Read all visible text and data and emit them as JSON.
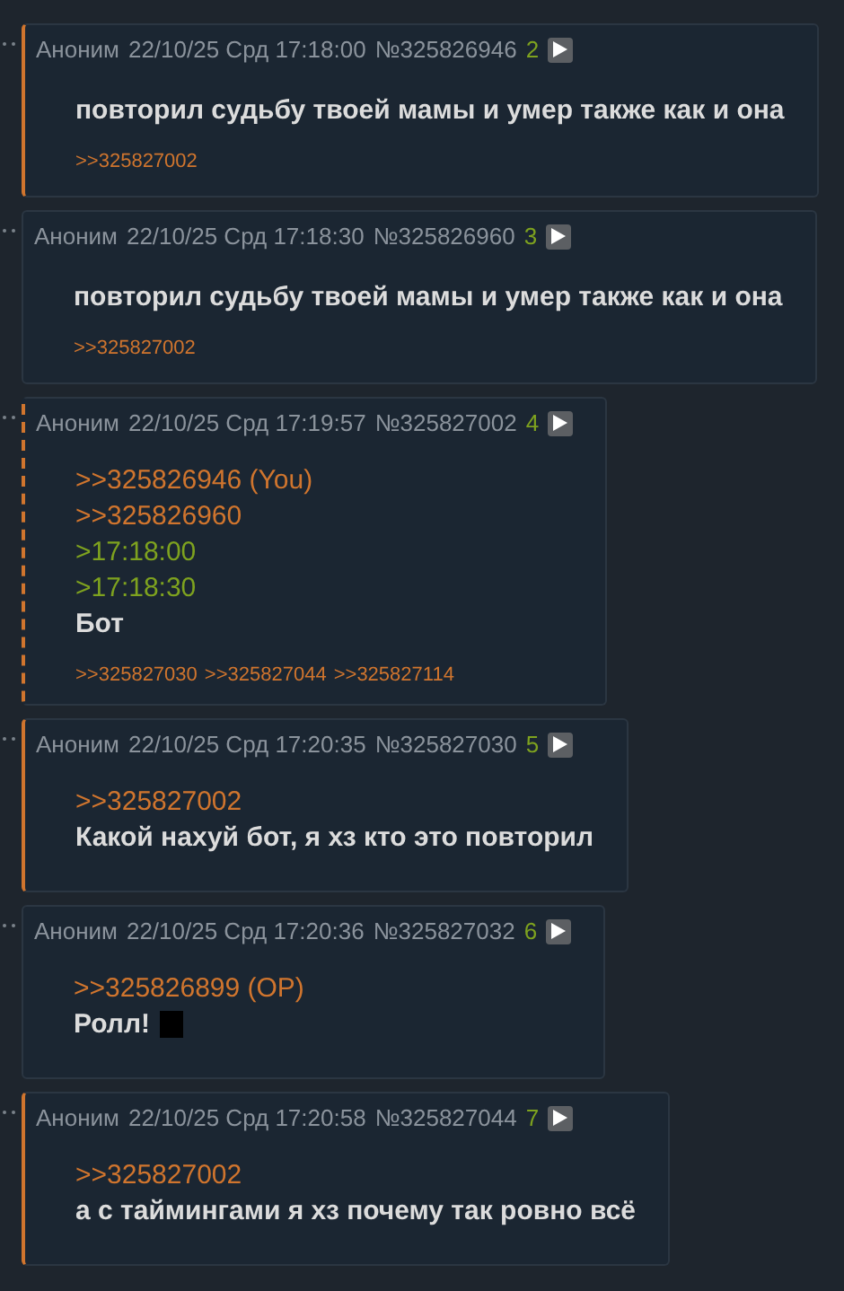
{
  "posts": [
    {
      "kind": "reply",
      "author": "Аноним",
      "date": "22/10/25 Срд 17:18:00",
      "number": "№325826946",
      "index": "2",
      "lines": [
        {
          "kind": "text",
          "text": "повторил судьбу твоей мамы и умер также как и она"
        }
      ],
      "replies": [
        ">>325827002"
      ]
    },
    {
      "kind": "plain",
      "author": "Аноним",
      "date": "22/10/25 Срд 17:18:30",
      "number": "№325826960",
      "index": "3",
      "lines": [
        {
          "kind": "text",
          "text": "повторил судьбу твоей мамы и умер также как и она"
        }
      ],
      "replies": [
        ">>325827002"
      ]
    },
    {
      "kind": "own",
      "author": "Аноним",
      "date": "22/10/25 Срд 17:19:57",
      "number": "№325827002",
      "index": "4",
      "lines": [
        {
          "kind": "link",
          "text": ">>325826946 (You)"
        },
        {
          "kind": "link",
          "text": ">>325826960"
        },
        {
          "kind": "quote",
          "text": ">17:18:00"
        },
        {
          "kind": "quote",
          "text": ">17:18:30"
        },
        {
          "kind": "text",
          "text": "Бот"
        }
      ],
      "replies": [
        ">>325827030",
        ">>325827044",
        ">>325827114"
      ]
    },
    {
      "kind": "reply",
      "author": "Аноним",
      "date": "22/10/25 Срд 17:20:35",
      "number": "№325827030",
      "index": "5",
      "lines": [
        {
          "kind": "link",
          "text": ">>325827002"
        },
        {
          "kind": "text",
          "text": "Какой нахуй бот, я хз кто это повторил"
        }
      ]
    },
    {
      "kind": "plain",
      "author": "Аноним",
      "date": "22/10/25 Срд 17:20:36",
      "number": "№325827032",
      "index": "6",
      "lines": [
        {
          "kind": "link",
          "text": ">>325826899 (OP)"
        },
        {
          "kind": "text",
          "text": "Ролл!",
          "spoiler": true
        }
      ]
    },
    {
      "kind": "reply",
      "author": "Аноним",
      "date": "22/10/25 Срд 17:20:58",
      "number": "№325827044",
      "index": "7",
      "lines": [
        {
          "kind": "link",
          "text": ">>325827002"
        },
        {
          "kind": "text",
          "text": "а с таймингами я хз почему так ровно всё"
        }
      ]
    }
  ]
}
